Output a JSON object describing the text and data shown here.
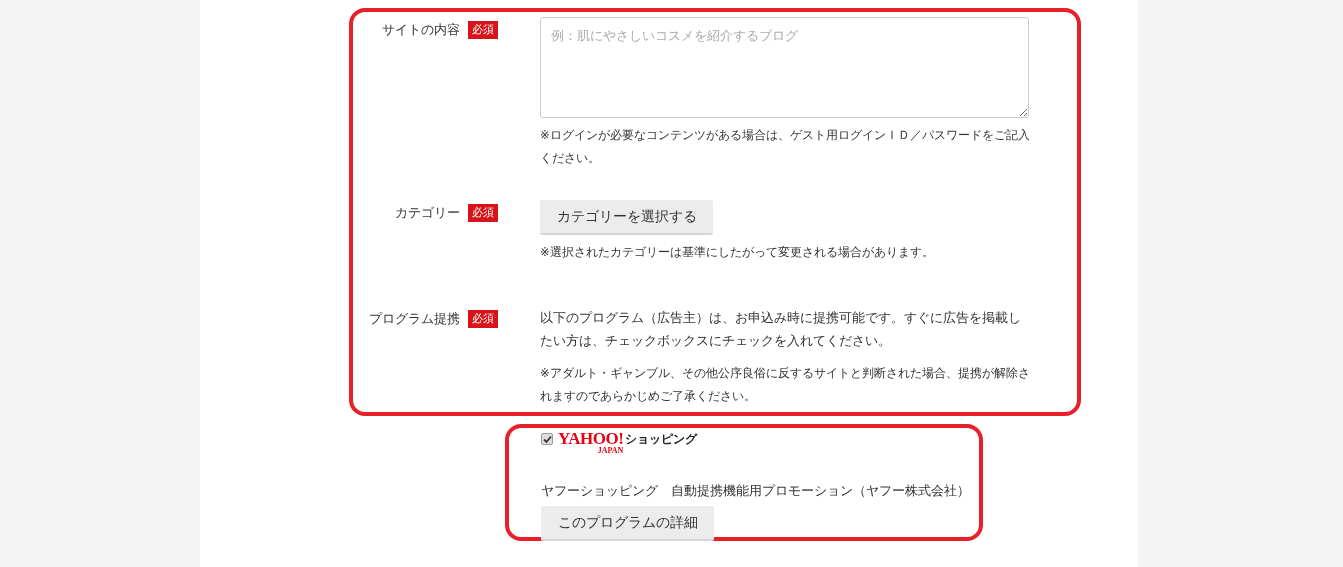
{
  "fields": [
    {
      "kind": "textarea",
      "label": "サイトの内容",
      "badge": "必須",
      "placeholder": "例：肌にやさしいコスメを紹介するブログ",
      "notes": [
        "※ログインが必要なコンテンツがある場合は、ゲスト用ログインＩＤ／パスワードをご記入ください。"
      ]
    },
    {
      "kind": "button",
      "label": "カテゴリー",
      "badge": "必須",
      "button": "カテゴリーを選択する",
      "notes": [
        "※選択されたカテゴリーは基準にしたがって変更される場合があります。"
      ]
    },
    {
      "kind": "text",
      "label": "プログラム提携",
      "badge": "必須",
      "notes": [
        "以下のプログラム（広告主）は、お申込み時に提携可能です。すぐに広告を掲載したい方は、チェックボックスにチェックを入れてください。",
        "※アダルト・ギャンブル、その他公序良俗に反するサイトと判断された場合、提携が解除されますのであらかじめご了承ください。"
      ]
    }
  ],
  "program": {
    "checked": true,
    "logo": {
      "name": "YAHOO!",
      "sub": "JAPAN",
      "service": "ショッピング"
    },
    "title": "ヤフーショッピング　自動提携機能用プロモーション（ヤフー株式会社）",
    "button": "このプログラムの詳細"
  }
}
